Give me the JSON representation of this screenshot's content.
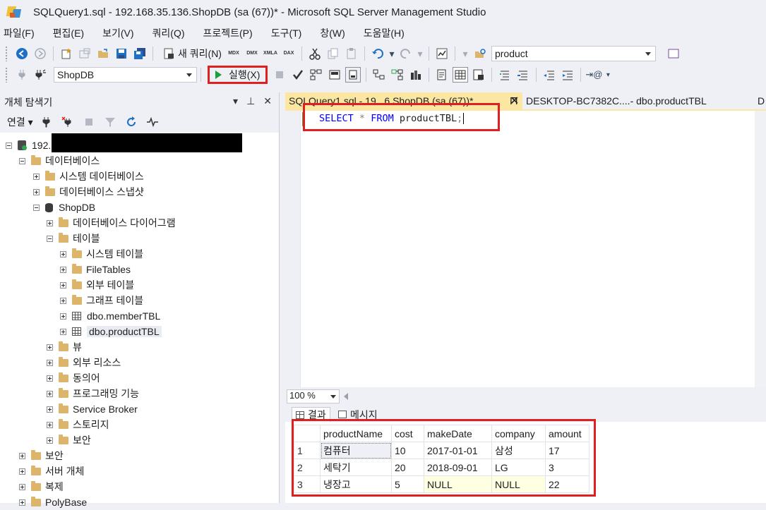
{
  "window": {
    "title": "SQLQuery1.sql - 192.168.35.136.ShopDB (sa (67))* - Microsoft SQL Server Management Studio"
  },
  "menu": [
    "파일(F)",
    "편집(E)",
    "보기(V)",
    "쿼리(Q)",
    "프로젝트(P)",
    "도구(T)",
    "창(W)",
    "도움말(H)"
  ],
  "toolbar": {
    "new_query": "새 쿼리(N)",
    "mdx": "MDX",
    "dmx": "DMX",
    "xmla": "XMLA",
    "dax": "DAX",
    "search_value": "product",
    "database": "ShopDB",
    "execute_label": "실행(X)"
  },
  "object_explorer": {
    "title": "개체 탐색기",
    "connect_label": "연결",
    "server": "192.",
    "nodes": {
      "databases": "데이터베이스",
      "system_databases": "시스템 데이터베이스",
      "db_snapshots": "데이터베이스 스냅샷",
      "shopdb": "ShopDB",
      "diagrams": "데이터베이스 다이어그램",
      "tables": "테이블",
      "system_tables": "시스템 테이블",
      "filetables": "FileTables",
      "external_tables": "외부 테이블",
      "graph_tables": "그래프 테이블",
      "member_tbl": "dbo.memberTBL",
      "product_tbl": "dbo.productTBL",
      "views": "뷰",
      "external_resources": "외부 리소스",
      "synonyms": "동의어",
      "programmability": "프로그래밍 기능",
      "service_broker": "Service Broker",
      "storage": "스토리지",
      "security_db": "보안",
      "security": "보안",
      "server_objects": "서버 개체",
      "replication": "복제",
      "polybase": "PolyBase"
    }
  },
  "editor": {
    "tab_active": "SQLQuery1.sql - 19...6.ShopDB (sa (67))*",
    "tab_second": "DESKTOP-BC7382C....- dbo.productTBL",
    "tab_third": "D",
    "code": {
      "kw_select": "SELECT",
      "star": "*",
      "kw_from": "FROM",
      "table": "productTBL",
      "semicolon": ";"
    },
    "zoom": "100 %"
  },
  "results": {
    "tab_results": "결과",
    "tab_messages": "메시지",
    "columns": [
      "productName",
      "cost",
      "makeDate",
      "company",
      "amount"
    ],
    "rows": [
      [
        "1",
        "컴퓨터",
        "10",
        "2017-01-01",
        "삼성",
        "17"
      ],
      [
        "2",
        "세탁기",
        "20",
        "2018-09-01",
        "LG",
        "3"
      ],
      [
        "3",
        "냉장고",
        "5",
        "NULL",
        "NULL",
        "22"
      ]
    ]
  }
}
